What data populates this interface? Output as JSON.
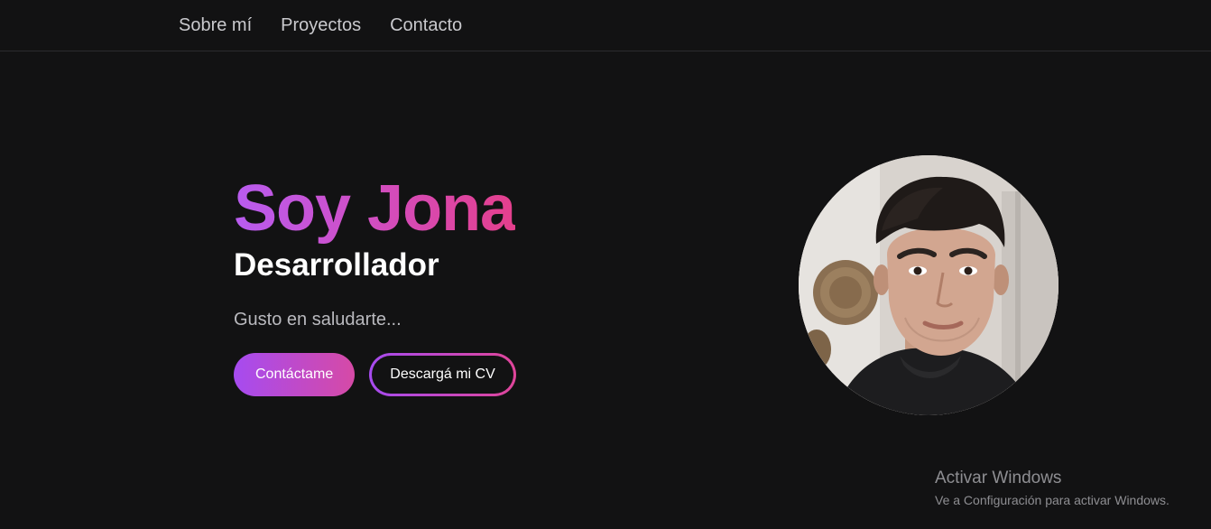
{
  "nav": {
    "items": [
      {
        "label": "Sobre mí"
      },
      {
        "label": "Proyectos"
      },
      {
        "label": "Contacto"
      }
    ]
  },
  "hero": {
    "title": "Soy Jona",
    "subtitle": "Desarrollador",
    "greeting": "Gusto en saludarte...",
    "primary_button": "Contáctame",
    "secondary_button": "Descargá mi CV"
  },
  "profile_photo": {
    "icon": "profile-photo"
  },
  "watermark": {
    "title": "Activar Windows",
    "subtitle": "Ve a Configuración para activar Windows."
  },
  "colors": {
    "background": "#121213",
    "accent_start": "#b85cf0",
    "accent_end": "#e43f8c"
  }
}
